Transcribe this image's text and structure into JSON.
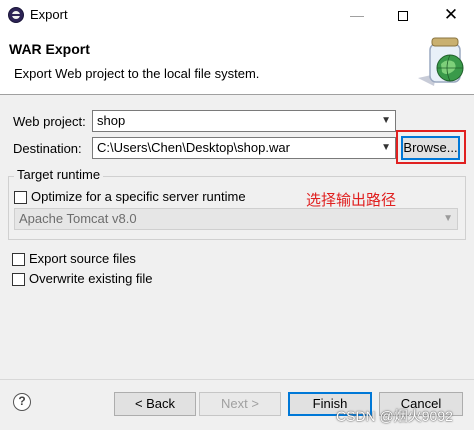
{
  "window": {
    "title": "Export",
    "minimize_glyph": "—",
    "close_glyph": "✕"
  },
  "header": {
    "title": "WAR Export",
    "description": "Export Web project to the local file system."
  },
  "form": {
    "web_project_label": "Web project:",
    "web_project_value": "shop",
    "destination_label": "Destination:",
    "destination_value": "C:\\Users\\Chen\\Desktop\\shop.war",
    "browse_label": "Browse...",
    "target_runtime_label": "Target runtime",
    "optimize_label": "Optimize for a specific server runtime",
    "optimize_checked": false,
    "runtime_value": "Apache Tomcat v8.0",
    "export_source_label": "Export source files",
    "export_source_checked": false,
    "overwrite_label": "Overwrite existing file",
    "overwrite_checked": false
  },
  "annotation": {
    "text": "选择输出路径",
    "color": "#e02020"
  },
  "footer": {
    "help_glyph": "?",
    "back_label": "< Back",
    "next_label": "Next >",
    "finish_label": "Finish",
    "cancel_label": "Cancel"
  },
  "watermark": "CSDN @烟火9092",
  "colors": {
    "focus": "#0078d7",
    "highlight": "#e02020"
  },
  "icons": [
    "eclipse-icon",
    "minimize-icon",
    "maximize-icon",
    "close-icon",
    "jar-globe-icon",
    "dropdown-arrow-icon",
    "help-icon"
  ]
}
